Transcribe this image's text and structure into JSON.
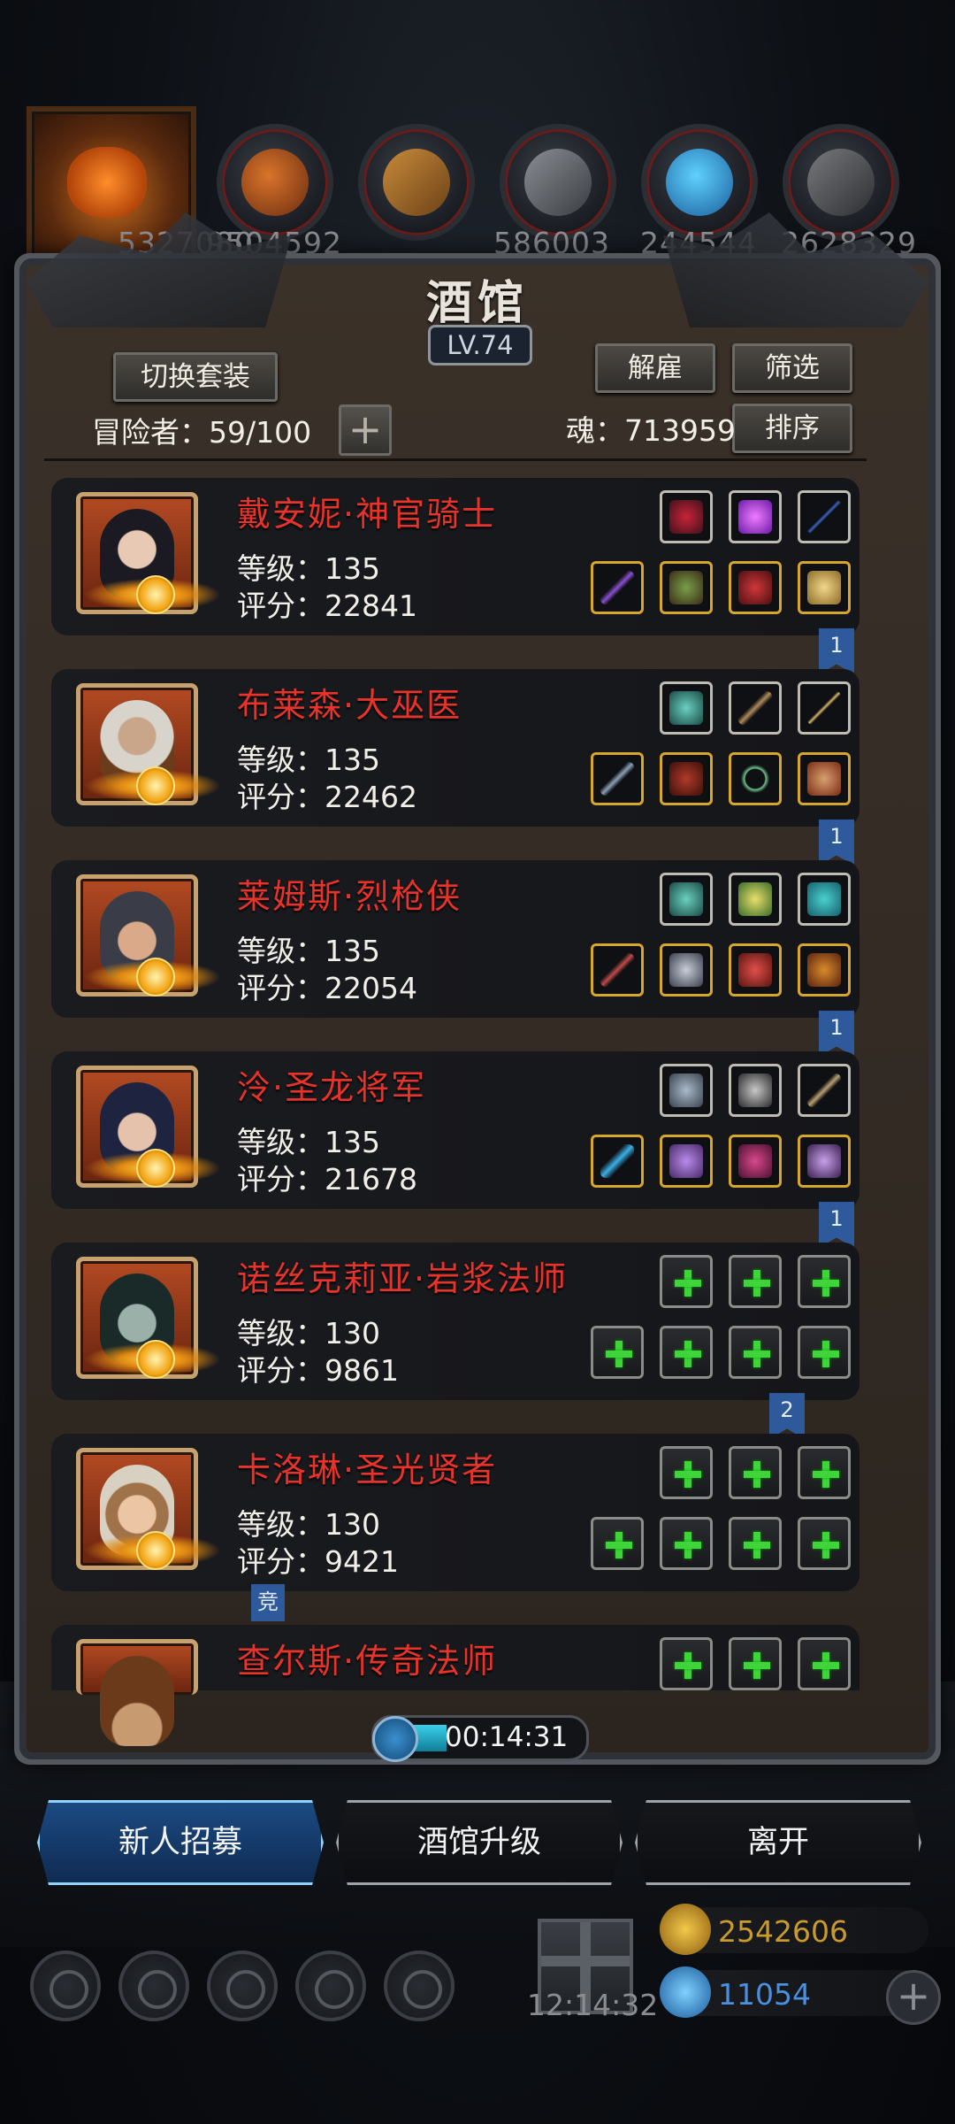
{
  "resources": [
    {
      "name": "pumpkin-avatar",
      "value": "5327080"
    },
    {
      "name": "meat-icon",
      "value": "9504592"
    },
    {
      "name": "wood-icon",
      "value": "586003"
    },
    {
      "name": "iron-icon",
      "value": "244544"
    },
    {
      "name": "crystal-icon",
      "value": "2628329"
    },
    {
      "name": "stone-icon",
      "value": ""
    }
  ],
  "tavern": {
    "title": "酒馆",
    "level": "LV.74",
    "switch_outfit": "切换套装",
    "dismiss": "解雇",
    "filter": "筛选",
    "sort": "排序",
    "adventurers": "冒险者：59/100",
    "soul": "魂：713959"
  },
  "heroes": [
    {
      "name": "戴安妮·神官骑士",
      "level": "等级：135",
      "score": "评分：22841",
      "badge": "1"
    },
    {
      "name": "布莱森·大巫医",
      "level": "等级：135",
      "score": "评分：22462",
      "badge": "1"
    },
    {
      "name": "莱姆斯·烈枪侠",
      "level": "等级：135",
      "score": "评分：22054",
      "badge": "1"
    },
    {
      "name": "泠·圣龙将军",
      "level": "等级：135",
      "score": "评分：21678",
      "badge": "1"
    },
    {
      "name": "诺丝克莉亚·岩浆法师",
      "level": "等级：130",
      "score": "评分：9861",
      "badge": "2"
    },
    {
      "name": "卡洛琳·圣光贤者",
      "level": "等级：130",
      "score": "评分：9421",
      "badge": "竞"
    },
    {
      "name": "查尔斯·传奇法师",
      "level": "",
      "score": "",
      "badge": ""
    }
  ],
  "timer": "00:14:31",
  "bottom_buttons": {
    "recruit": "新人招募",
    "upgrade": "酒馆升级",
    "leave": "离开"
  },
  "footer": {
    "clock": "12:14:32",
    "gold": "2542606",
    "gems": "11054"
  },
  "colors": {
    "hero_name": "#e7332a",
    "active_button": "#1c4a82",
    "badge": "#2e5a9c",
    "gold_text": "#c99a2e",
    "gem_text": "#4a8fe0"
  }
}
